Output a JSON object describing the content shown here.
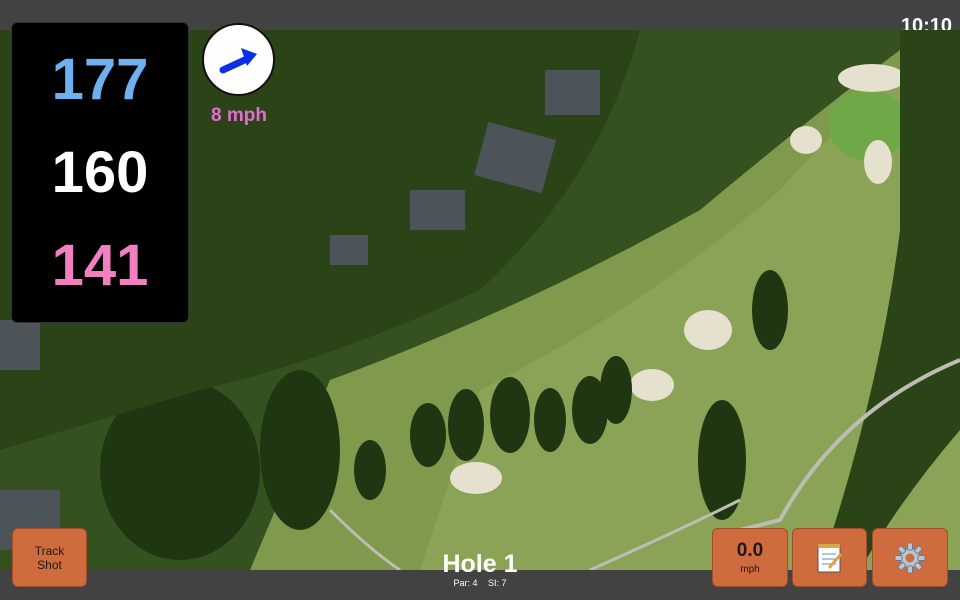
{
  "status": {
    "time": "10:10"
  },
  "distances": {
    "back": "177",
    "center": "160",
    "front": "141"
  },
  "wind": {
    "speed": "8 mph",
    "icon": "wind-arrow-icon"
  },
  "buttons": {
    "track_shot_line1": "Track",
    "track_shot_line2": "Shot",
    "speed_value": "0.0",
    "speed_unit": "mph",
    "notes_icon": "notepad-icon",
    "settings_icon": "gear-icon"
  },
  "hole": {
    "title": "Hole 1",
    "par": "Par: 4",
    "si": "SI: 7"
  },
  "colors": {
    "back": "#6fb0f0",
    "center": "#ffffff",
    "front": "#f27fc0",
    "button": "#cf6b3c",
    "wind_speed": "#e46cd6"
  }
}
